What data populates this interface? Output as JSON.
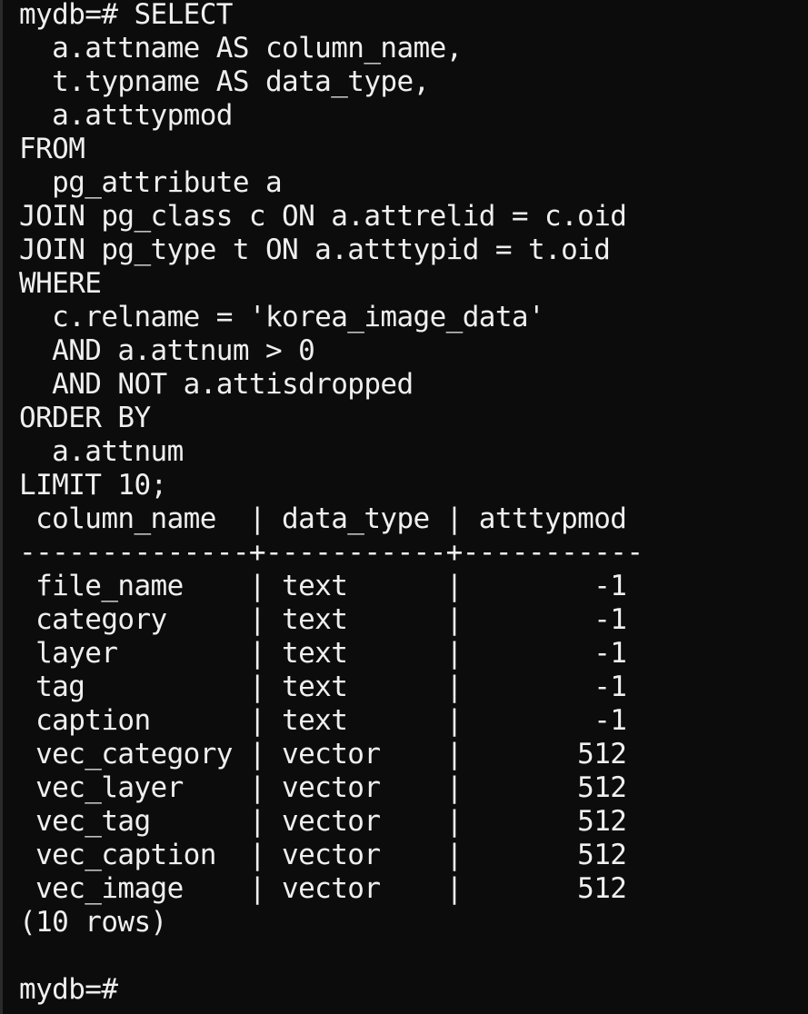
{
  "query_lines": [
    "mydb=# SELECT",
    "  a.attname AS column_name,",
    "  t.typname AS data_type,",
    "  a.atttypmod",
    "FROM",
    "  pg_attribute a",
    "JOIN pg_class c ON a.attrelid = c.oid",
    "JOIN pg_type t ON a.atttypid = t.oid",
    "WHERE",
    "  c.relname = 'korea_image_data'",
    "  AND a.attnum > 0",
    "  AND NOT a.attisdropped",
    "ORDER BY",
    "  a.attnum",
    "LIMIT 10;"
  ],
  "result_table": {
    "header": " column_name  | data_type | atttypmod",
    "separator": "--------------+-----------+-----------",
    "rows": [
      " file_name    | text      |        -1",
      " category     | text      |        -1",
      " layer        | text      |        -1",
      " tag          | text      |        -1",
      " caption      | text      |        -1",
      " vec_category | vector    |       512",
      " vec_layer    | vector    |       512",
      " vec_tag      | vector    |       512",
      " vec_caption  | vector    |       512",
      " vec_image    | vector    |       512"
    ],
    "footer": "(10 rows)"
  },
  "prompt": {
    "blank": "",
    "text": "mydb=#"
  }
}
